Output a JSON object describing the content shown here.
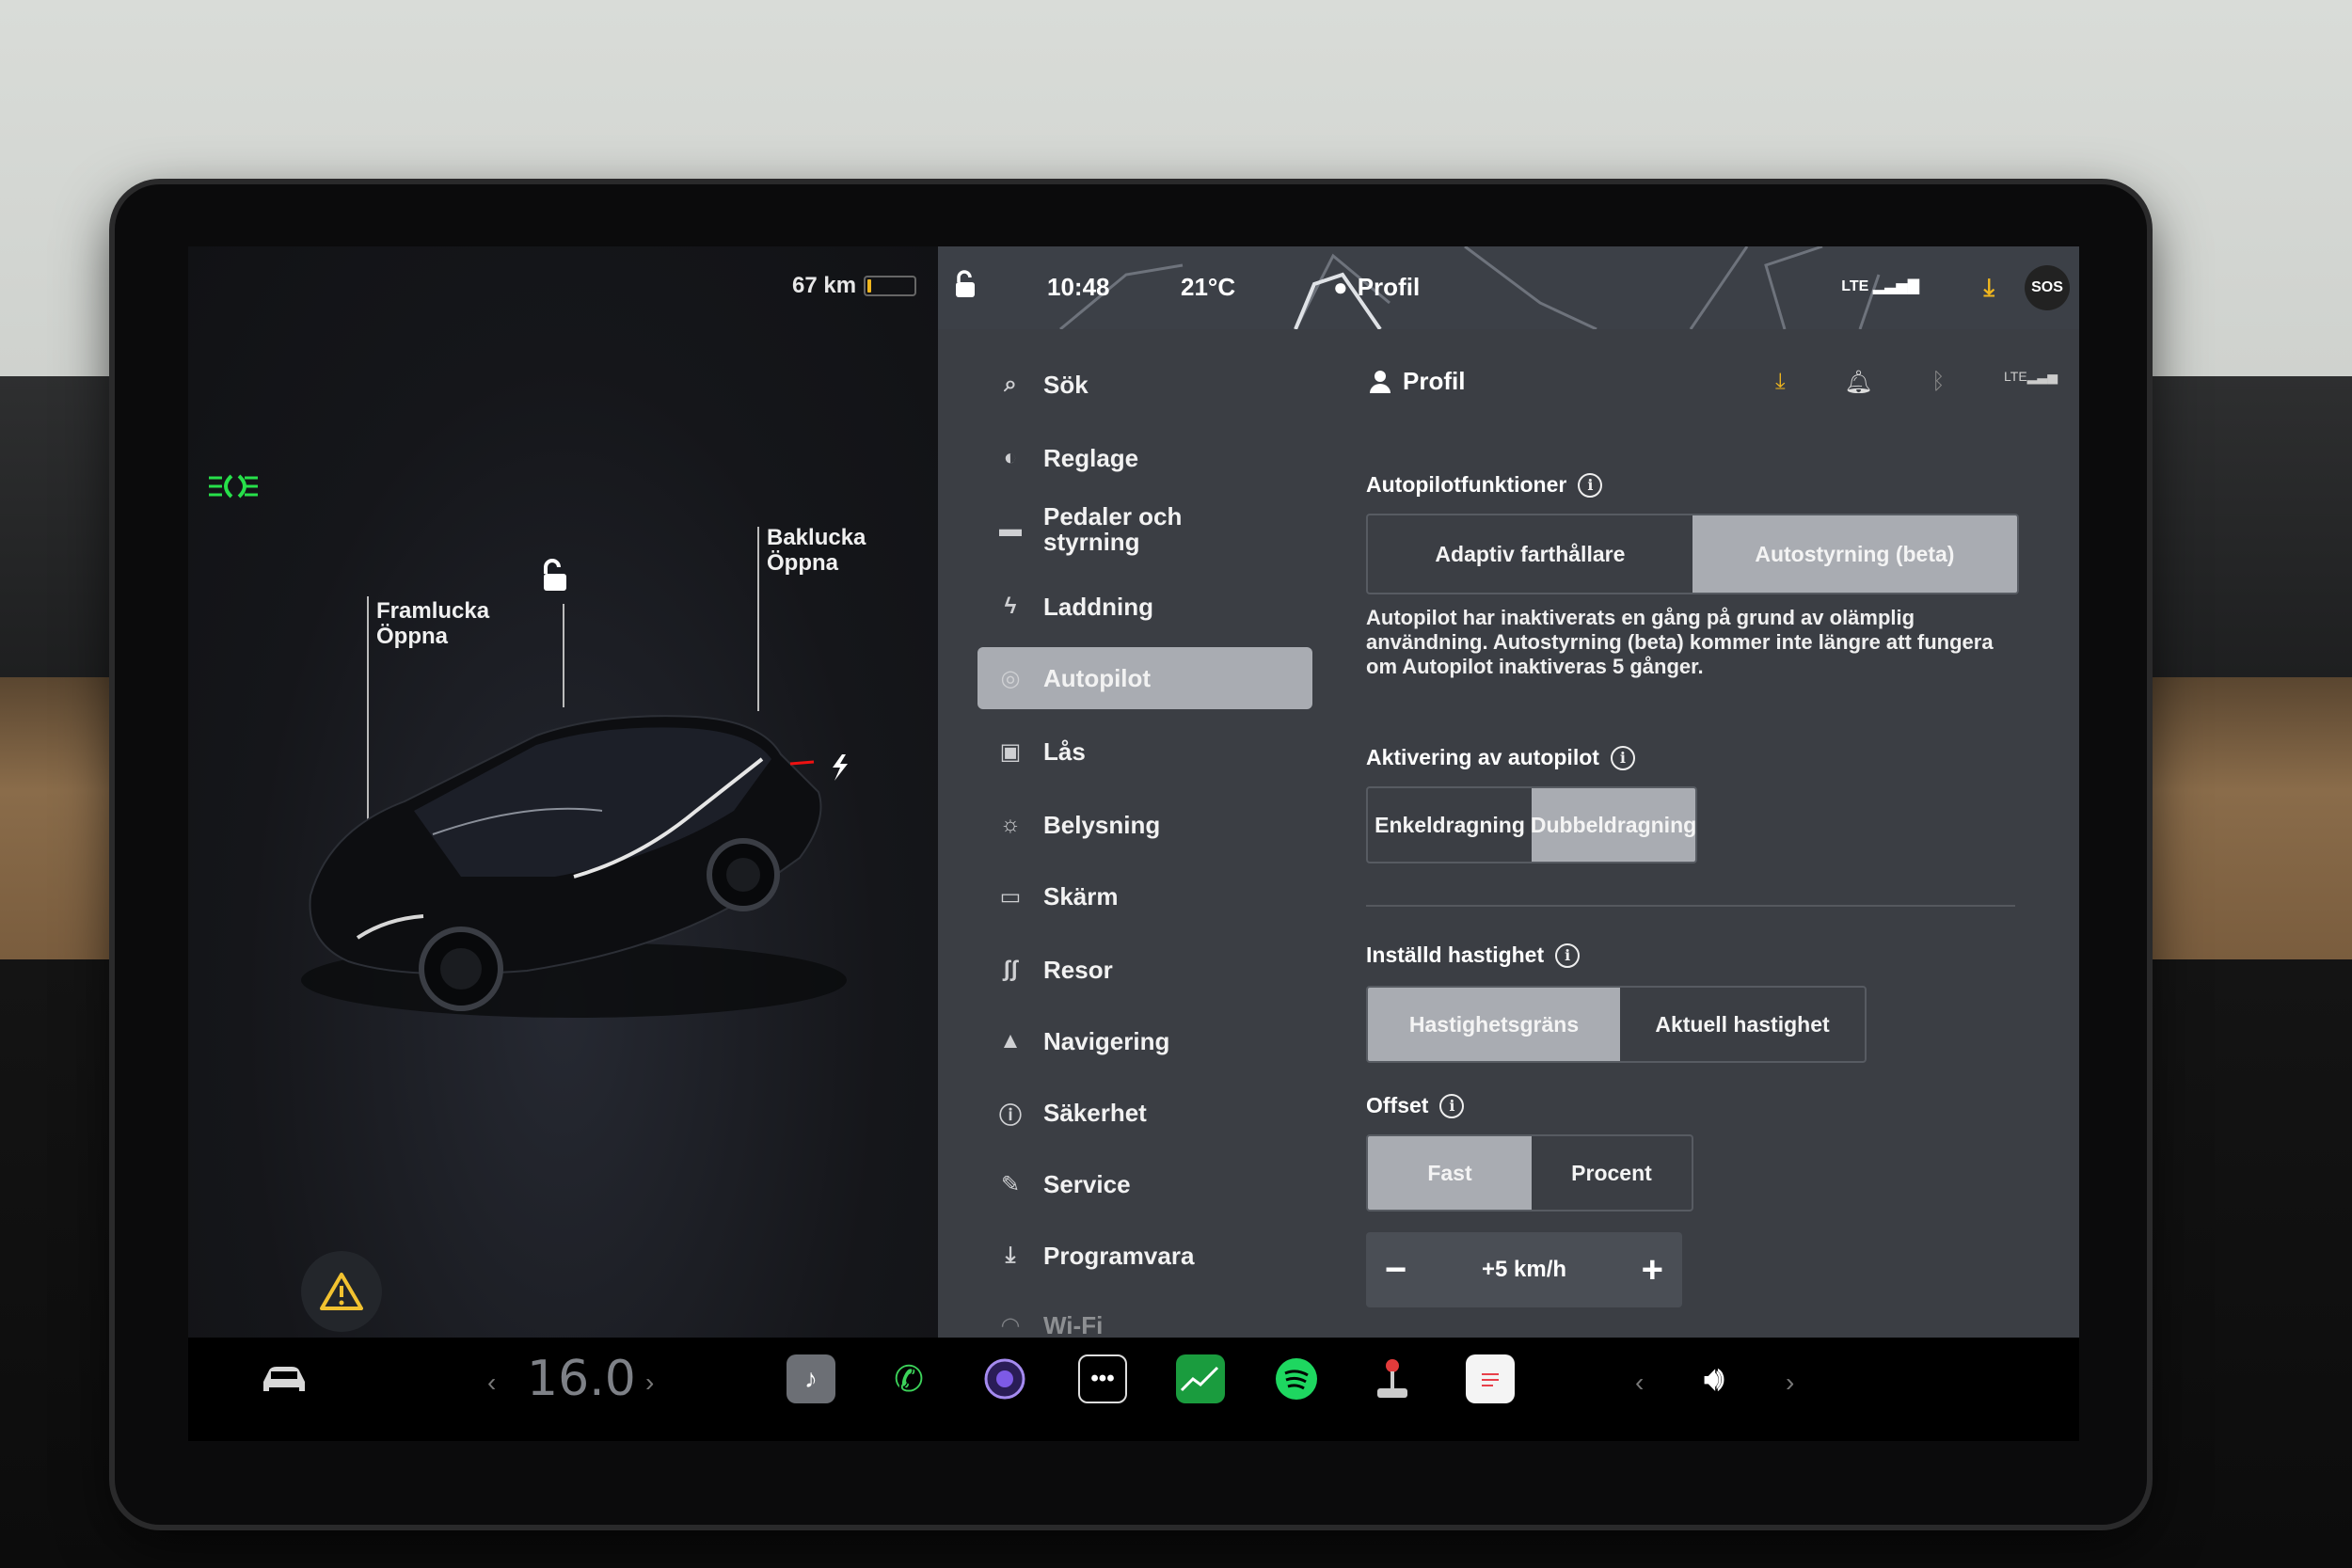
{
  "car": {
    "range": "67 km",
    "battery_level": 0.08,
    "frunk_label": "Framlucka",
    "frunk_action": "Öppna",
    "trunk_label": "Baklucka",
    "trunk_action": "Öppna",
    "headlight_icon": "headlight-icon",
    "colors": {
      "headlight": "#27e04a",
      "battery": "#f0b61e"
    }
  },
  "status": {
    "time": "10:48",
    "temperature": "21°C",
    "profile": "Profil",
    "network": "LTE",
    "sos": "SOS"
  },
  "menu": [
    {
      "label": "Sök",
      "icon": "search-icon"
    },
    {
      "label": "Reglage",
      "icon": "toggle-icon"
    },
    {
      "label": "Pedaler och styrning",
      "icon": "car-icon"
    },
    {
      "label": "Laddning",
      "icon": "bolt-icon"
    },
    {
      "label": "Autopilot",
      "icon": "steering-wheel-icon",
      "active": true
    },
    {
      "label": "Lås",
      "icon": "lock-icon"
    },
    {
      "label": "Belysning",
      "icon": "sun-icon"
    },
    {
      "label": "Skärm",
      "icon": "display-icon"
    },
    {
      "label": "Resor",
      "icon": "trips-icon"
    },
    {
      "label": "Navigering",
      "icon": "navigation-icon"
    },
    {
      "label": "Säkerhet",
      "icon": "safety-icon"
    },
    {
      "label": "Service",
      "icon": "wrench-icon"
    },
    {
      "label": "Programvara",
      "icon": "download-icon"
    },
    {
      "label": "Wi-Fi",
      "icon": "wifi-icon"
    }
  ],
  "content": {
    "profile_title": "Profil",
    "autopilot_features": {
      "title": "Autopilotfunktioner",
      "options": [
        "Adaptiv farthållare",
        "Autostyrning (beta)"
      ],
      "selected": 1,
      "description": "Autopilot har inaktiverats en gång på grund av olämplig användning. Autostyrning (beta) kommer inte längre att fungera om Autopilot inaktiveras 5 gånger."
    },
    "activation": {
      "title": "Aktivering av autopilot",
      "options": [
        "Enkeldragning",
        "Dubbeldragning"
      ],
      "selected": 1
    },
    "set_speed": {
      "title": "Inställd hastighet",
      "options": [
        "Hastighetsgräns",
        "Aktuell hastighet"
      ],
      "selected": 0
    },
    "offset": {
      "title": "Offset",
      "options": [
        "Fast",
        "Procent"
      ],
      "selected": 0,
      "value": "+5 km/h",
      "minus": "−",
      "plus": "+"
    }
  },
  "taskbar": {
    "temperature": "16.0",
    "apps": [
      "music-icon",
      "phone-icon",
      "camera-icon",
      "more-icon",
      "stocks-icon",
      "spotify-icon",
      "joystick-icon",
      "notes-icon"
    ],
    "volume_icon": "volume-icon"
  }
}
